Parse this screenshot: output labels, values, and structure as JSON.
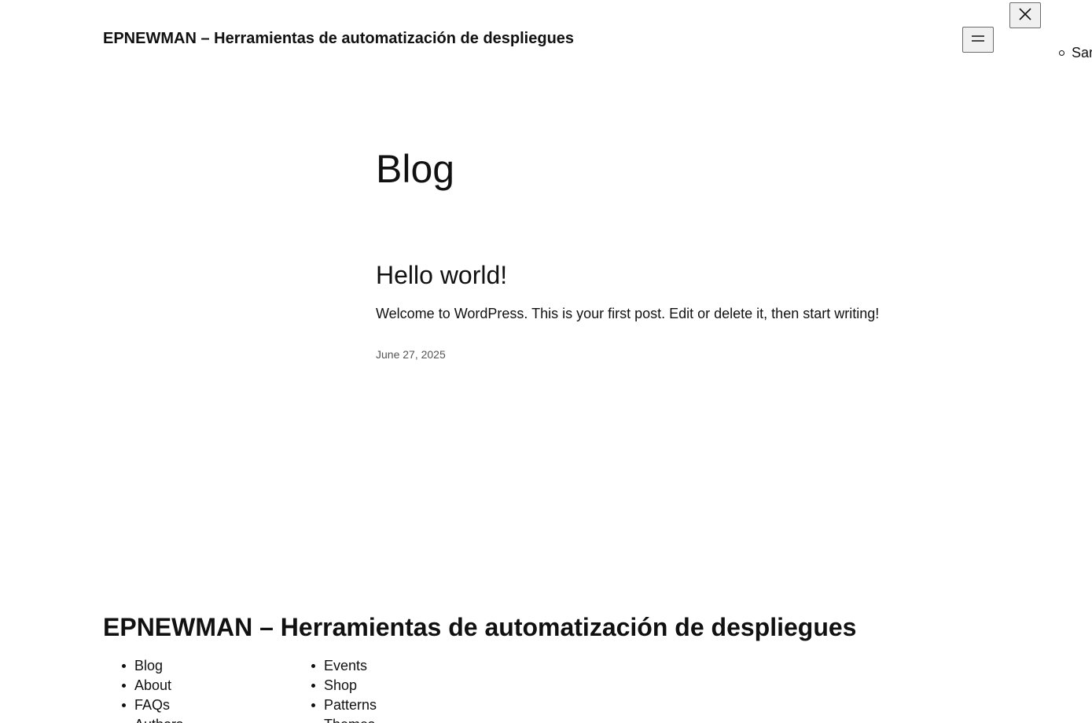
{
  "header": {
    "site_title": "EPNEWMAN – Herramientas de automatización de despliegues",
    "open_menu_icon": "hamburger-icon",
    "close_menu_icon": "close-icon",
    "overflow_nav": [
      "Sar"
    ]
  },
  "main": {
    "page_title": "Blog",
    "posts": [
      {
        "title": "Hello world!",
        "excerpt": "Welcome to WordPress. This is your first post. Edit or delete it, then start writing!",
        "date": "June 27, 2025"
      }
    ]
  },
  "footer": {
    "site_title": "EPNEWMAN – Herramientas de automatización de despliegues",
    "nav_column_1": [
      "Blog",
      "About",
      "FAQs",
      "Authors"
    ],
    "nav_column_2": [
      "Events",
      "Shop",
      "Patterns",
      "Themes"
    ]
  }
}
